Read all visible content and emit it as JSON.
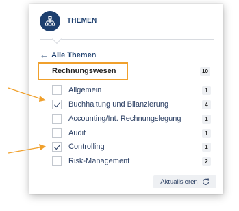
{
  "header": {
    "title": "THEMEN",
    "icon": "org-chart-icon"
  },
  "back_link": {
    "label": "Alle Themen"
  },
  "category": {
    "label": "Rechnungswesen",
    "count": "10"
  },
  "items": [
    {
      "label": "Allgemein",
      "count": "1",
      "checked": false
    },
    {
      "label": "Buchhaltung und Bilanzierung",
      "count": "4",
      "checked": true
    },
    {
      "label": "Accounting/Int. Rechnungslegung",
      "count": "1",
      "checked": false
    },
    {
      "label": "Audit",
      "count": "1",
      "checked": false
    },
    {
      "label": "Controlling",
      "count": "1",
      "checked": true
    },
    {
      "label": "Risk-Management",
      "count": "2",
      "checked": false
    }
  ],
  "update_button": {
    "label": "Aktualisieren"
  },
  "colors": {
    "brand": "#1d3f6e",
    "highlight": "#f0a02c",
    "badge_bg": "#eef0f3"
  }
}
